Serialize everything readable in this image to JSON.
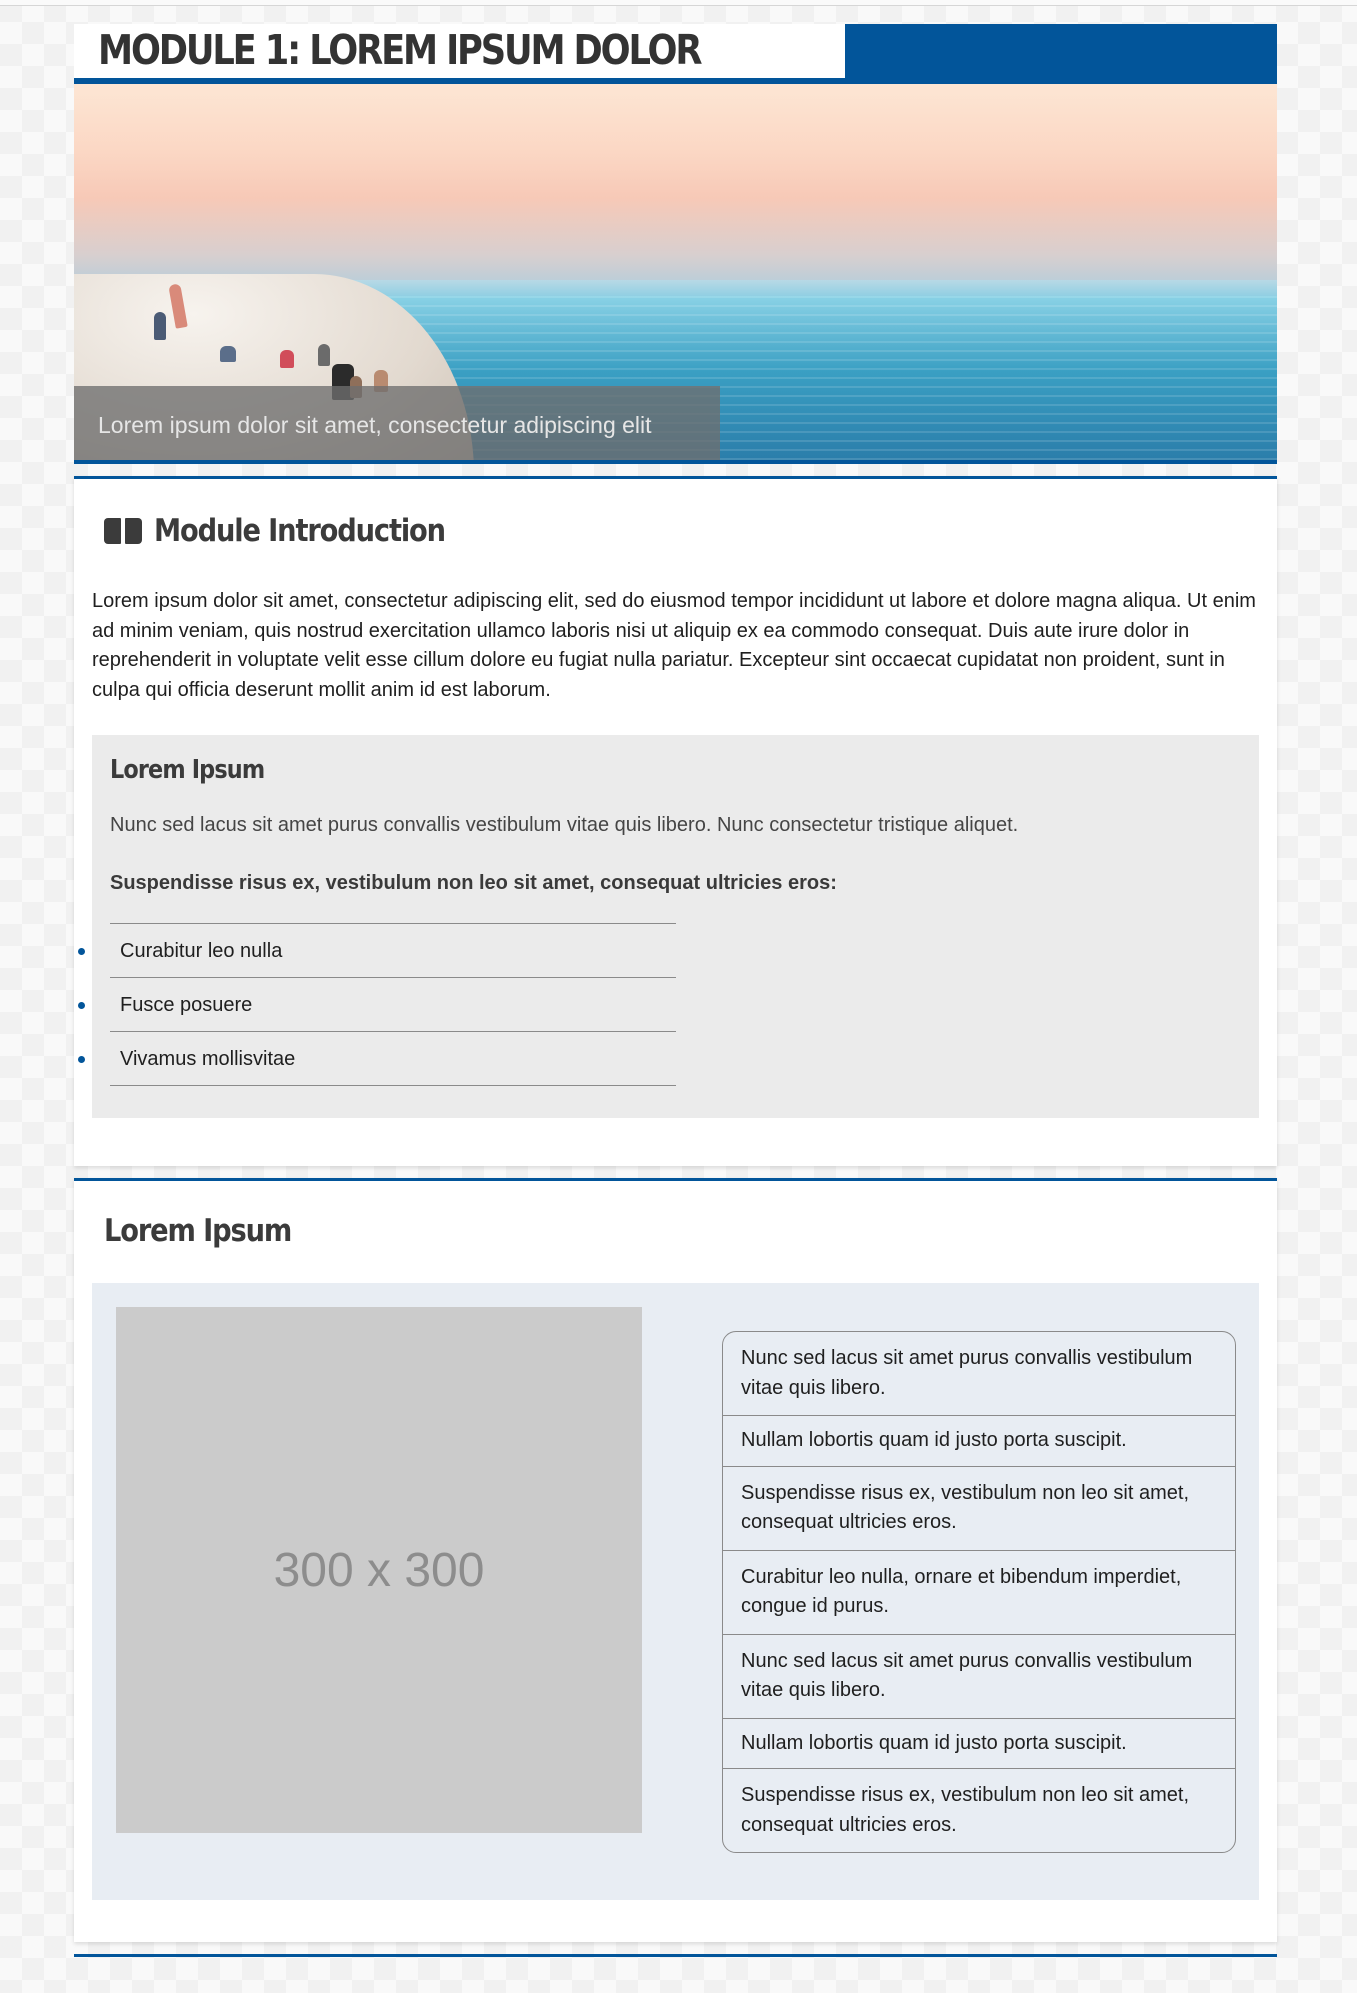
{
  "module": {
    "title": "MODULE 1: LOREM IPSUM DOLOR",
    "brand_color": "#02559a"
  },
  "hero": {
    "caption": "Lorem ipsum dolor sit amet, consectetur adipiscing elit"
  },
  "intro": {
    "heading": "Module Introduction",
    "icon": "book-open-icon",
    "paragraph": "Lorem ipsum dolor sit amet, consectetur adipiscing elit, sed do eiusmod tempor incididunt ut labore et dolore magna aliqua. Ut enim ad minim veniam, quis nostrud exercitation ullamco laboris nisi ut aliquip ex ea commodo consequat. Duis aute irure dolor in reprehenderit in voluptate velit esse cillum dolore eu fugiat nulla pariatur. Excepteur sint occaecat cupidatat non proident, sunt in culpa qui officia deserunt mollit anim id est laborum.",
    "box": {
      "title": "Lorem Ipsum",
      "text": "Nunc sed lacus sit amet purus convallis vestibulum vitae quis libero. Nunc consectetur tristique aliquet.",
      "bold_text": "Suspendisse risus ex, vestibulum non leo sit amet, consequat ultricies eros:",
      "items": [
        "Curabitur leo nulla",
        "Fusce posuere",
        "Vivamus mollisvitae"
      ]
    }
  },
  "section2": {
    "heading": "Lorem Ipsum",
    "placeholder_label": "300 x 300",
    "list": [
      "Nunc sed lacus sit amet purus convallis vestibulum vitae quis libero.",
      "Nullam lobortis quam id justo porta suscipit.",
      "Suspendisse risus ex, vestibulum non leo sit amet, consequat ultricies eros.",
      "Curabitur leo nulla, ornare et bibendum imperdiet, congue id purus.",
      "Nunc sed lacus sit amet purus convallis vestibulum vitae quis libero.",
      "Nullam lobortis quam id justo porta suscipit.",
      "Suspendisse risus ex, vestibulum non leo sit amet, consequat ultricies eros."
    ]
  }
}
